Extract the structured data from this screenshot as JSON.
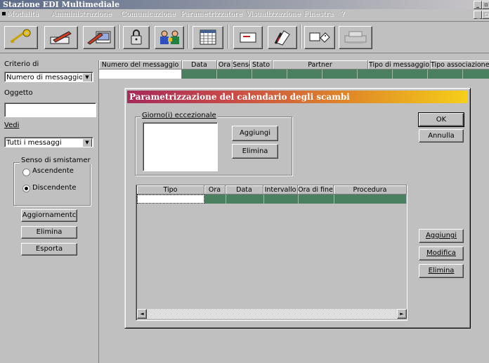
{
  "window": {
    "title": "Stazione EDI Multimediale"
  },
  "menu": [
    "Modalità",
    "Amministrazione",
    "Comunicazione",
    "Parametrizzatore",
    "Visualizzazione",
    "Finestra",
    "?"
  ],
  "toolbar": {
    "icons": [
      "key-icon",
      "new-message-icon",
      "edit-message-icon",
      "lock-icon",
      "users-icon",
      "calendar-icon",
      "envelope-icon",
      "document-signature-icon",
      "tag-message-icon",
      "printer-icon"
    ]
  },
  "left": {
    "criterio_label": "Criterio di",
    "criterio_value": "Numero di messaggio",
    "oggetto_label": "Oggetto",
    "oggetto_value": "",
    "vedi_label": "Vedi",
    "vedi_value": "Tutti i messaggi",
    "senso_label": "Senso di smistamer",
    "ascendente": "Ascendente",
    "discendente": "Discendente",
    "btn_aggiornamento": "Aggiornamentc",
    "btn_elimina": "Elimina",
    "btn_esporta": "Esporta"
  },
  "grid": {
    "columns": [
      "Numero del messaggio",
      "Data",
      "Ora",
      "Sensc",
      "Stato",
      "Partner",
      "Tipo di messaggio",
      "Tipo associazione"
    ]
  },
  "dialog": {
    "title": "Parametrizzazione del calendario degli scambi",
    "giorni_label": "Giorno(i) eccezionale",
    "btn_aggiungi_top": "Aggiungi",
    "btn_elimina_top": "Elimina",
    "btn_ok": "OK",
    "btn_annulla": "Annulla",
    "columns": [
      "Tipo",
      "Ora",
      "Data",
      "Intervallo",
      "Ora di fine",
      "Procedura"
    ],
    "btn_aggiungi": "Aggiungi",
    "btn_modifica": "Modifica",
    "btn_elimina": "Elimina"
  }
}
